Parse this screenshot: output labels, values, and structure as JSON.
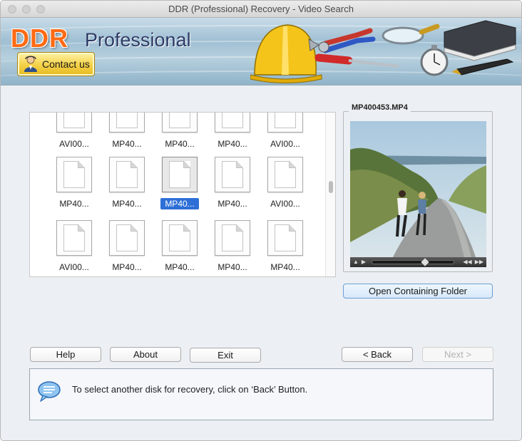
{
  "window": {
    "title": "DDR (Professional) Recovery - Video Search"
  },
  "banner": {
    "brand": "DDR",
    "edition": "Professional",
    "contact_label": "Contact us"
  },
  "files": [
    {
      "label": "AVI00..."
    },
    {
      "label": "MP40..."
    },
    {
      "label": "MP40..."
    },
    {
      "label": "MP40..."
    },
    {
      "label": "AVI00..."
    },
    {
      "label": "MP40..."
    },
    {
      "label": "MP40..."
    },
    {
      "label": "MP40...",
      "selected": true
    },
    {
      "label": "MP40..."
    },
    {
      "label": "AVI00..."
    },
    {
      "label": "AVI00..."
    },
    {
      "label": "MP40..."
    },
    {
      "label": "MP40..."
    },
    {
      "label": "MP40..."
    },
    {
      "label": "MP40..."
    }
  ],
  "preview": {
    "filename": "MP400453.MP4",
    "open_folder_label": "Open Containing Folder"
  },
  "buttons": {
    "help": "Help",
    "about": "About",
    "exit": "Exit",
    "back": "< Back",
    "next": "Next >"
  },
  "status": {
    "message": "To select another disk for recovery, click on ‘Back’ Button."
  }
}
